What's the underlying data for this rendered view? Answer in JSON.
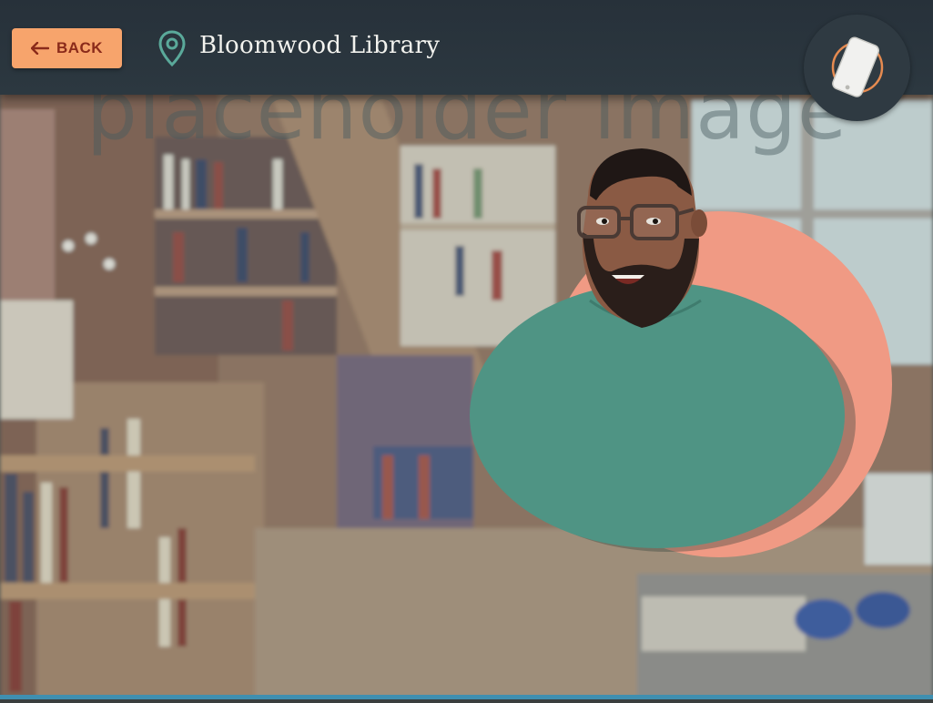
{
  "header": {
    "back_label": "BACK",
    "location_name": "Bloomwood Library"
  },
  "icons": {
    "back": "arrow-left-icon",
    "location": "map-pin-icon",
    "phone": "phone-icon"
  },
  "watermark_text": "placeholder image",
  "colors": {
    "header_bg": "#2a353d",
    "back_button": "#f7a46c",
    "back_text": "#8a2a1a",
    "pin_accent": "#5aa99a",
    "phone_ring": "#e58a50",
    "character_circle": "#f09a84",
    "character_shirt": "#4f9484"
  }
}
